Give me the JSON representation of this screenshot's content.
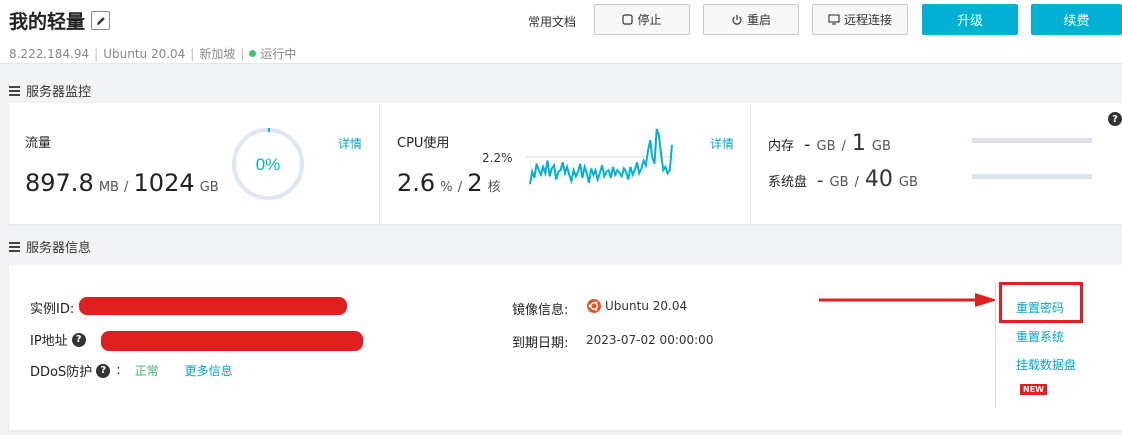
{
  "header": {
    "title": "我的轻量",
    "ip": "8.222.184.94",
    "os": "Ubuntu  20.04",
    "region": "新加坡",
    "status": "运行中",
    "docs_label": "常用文档",
    "stop_label": "停止",
    "restart_label": "重启",
    "remote_label": "远程连接",
    "upgrade_label": "升级",
    "renew_label": "续费",
    "status_color": "#3cc46b",
    "accent_color": "#00b1d4"
  },
  "monitor": {
    "section_title": "服务器监控",
    "traffic": {
      "label": "流量",
      "used": "897.8",
      "used_unit": "MB",
      "total": "1024",
      "total_unit": "GB",
      "percent_label": "0%",
      "percent_value": 0,
      "detail": "详情"
    },
    "cpu": {
      "label": "CPU使用",
      "peak_label": "2.2%",
      "value": "2.6",
      "value_unit": "%",
      "cores": "2",
      "cores_unit": "核",
      "detail": "详情",
      "sparkline": [
        0.15,
        0.55,
        0.35,
        0.8,
        0.6,
        0.45,
        0.7,
        0.5,
        0.9,
        0.4,
        0.65,
        0.75,
        0.3,
        0.55,
        0.6,
        0.85,
        0.5,
        0.7,
        0.45,
        0.25,
        0.6,
        0.4,
        0.55,
        0.8,
        0.35,
        0.7,
        0.5,
        0.2,
        0.65,
        0.45,
        0.6,
        0.3,
        0.5,
        0.75,
        0.4,
        0.55,
        0.6,
        0.35,
        0.7,
        0.45,
        0.6,
        0.5,
        0.4,
        0.65,
        0.55,
        0.3,
        0.7,
        0.45,
        0.6,
        0.85,
        0.5,
        0.65,
        0.9,
        0.75,
        1.2,
        1.55,
        1.0,
        0.8,
        1.9,
        1.7,
        1.1,
        0.6,
        0.7,
        0.5,
        0.6,
        1.4
      ]
    },
    "memory": {
      "label": "内存",
      "used": "-",
      "used_unit": "GB",
      "total": "1",
      "total_unit": "GB"
    },
    "disk": {
      "label": "系统盘",
      "used": "-",
      "used_unit": "GB",
      "total": "40",
      "total_unit": "GB"
    },
    "help_icon": "question-circle-icon"
  },
  "info": {
    "section_title": "服务器信息",
    "instance_id_label": "实例ID:",
    "ip_label": "IP地址",
    "ddos_label": "DDoS防护",
    "ddos_status": "正常",
    "more_info": "更多信息",
    "image_label": "镜像信息:",
    "image_value": "Ubuntu 20.04",
    "expire_label": "到期日期:",
    "expire_value": "2023-07-02 00:00:00",
    "actions": {
      "reset_password": "重置密码",
      "reset_system": "重置系统",
      "mount_disk": "挂载数据盘",
      "new_badge": "NEW"
    }
  }
}
